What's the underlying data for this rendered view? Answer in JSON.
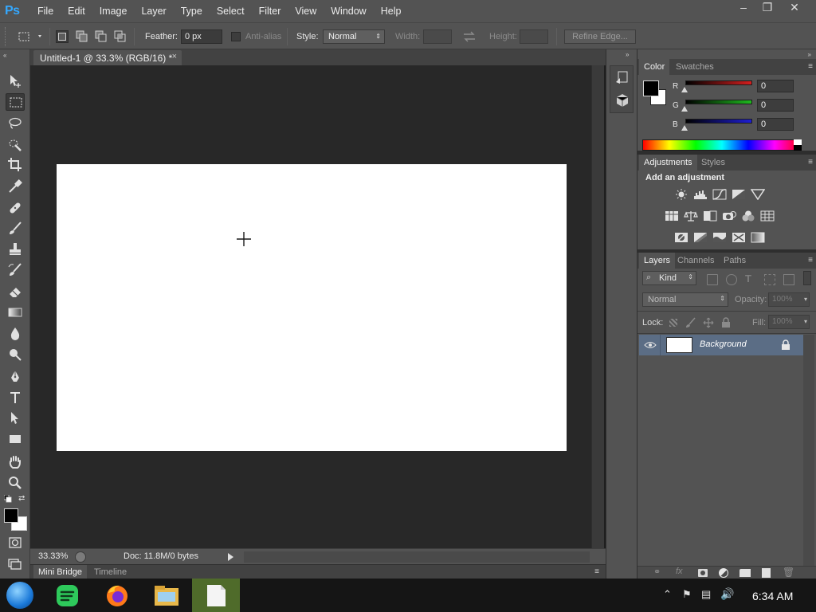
{
  "app": {
    "logo": "Ps",
    "menu": [
      "File",
      "Edit",
      "Image",
      "Layer",
      "Type",
      "Select",
      "Filter",
      "View",
      "Window",
      "Help"
    ],
    "window_controls": {
      "minimize": "–",
      "restore": "❐",
      "close": "✕"
    }
  },
  "options": {
    "feather_label": "Feather:",
    "feather_value": "0 px",
    "antialias_label": "Anti-alias",
    "style_label": "Style:",
    "style_value": "Normal",
    "width_label": "Width:",
    "height_label": "Height:",
    "refine_label": "Refine Edge..."
  },
  "document": {
    "tab_title": "Untitled-1 @ 33.3% (RGB/16) *",
    "close": "×",
    "zoom": "33.33%",
    "doc_info": "Doc: 11.8M/0 bytes"
  },
  "bottom_tabs": [
    "Mini Bridge",
    "Timeline"
  ],
  "color_panel": {
    "tabs": [
      "Color",
      "Swatches"
    ],
    "channels": [
      {
        "label": "R",
        "value": "0",
        "color": "#d41e1e"
      },
      {
        "label": "G",
        "value": "0",
        "color": "#1eb91e"
      },
      {
        "label": "B",
        "value": "0",
        "color": "#1e1ed4"
      }
    ]
  },
  "adjustments_panel": {
    "tabs": [
      "Adjustments",
      "Styles"
    ],
    "heading": "Add an adjustment"
  },
  "layers_panel": {
    "tabs": [
      "Layers",
      "Channels",
      "Paths"
    ],
    "kind_label": "Kind",
    "blend_mode": "Normal",
    "opacity_label": "Opacity:",
    "opacity_value": "100%",
    "lock_label": "Lock:",
    "fill_label": "Fill:",
    "fill_value": "100%",
    "layers": [
      {
        "name": "Background"
      }
    ]
  },
  "taskbar": {
    "time": "6:34 AM"
  },
  "colors": {
    "ui_bg": "#535353",
    "canvas_bg": "#282828",
    "selection": "#5b6d85",
    "ps_blue": "#34a8ff"
  }
}
